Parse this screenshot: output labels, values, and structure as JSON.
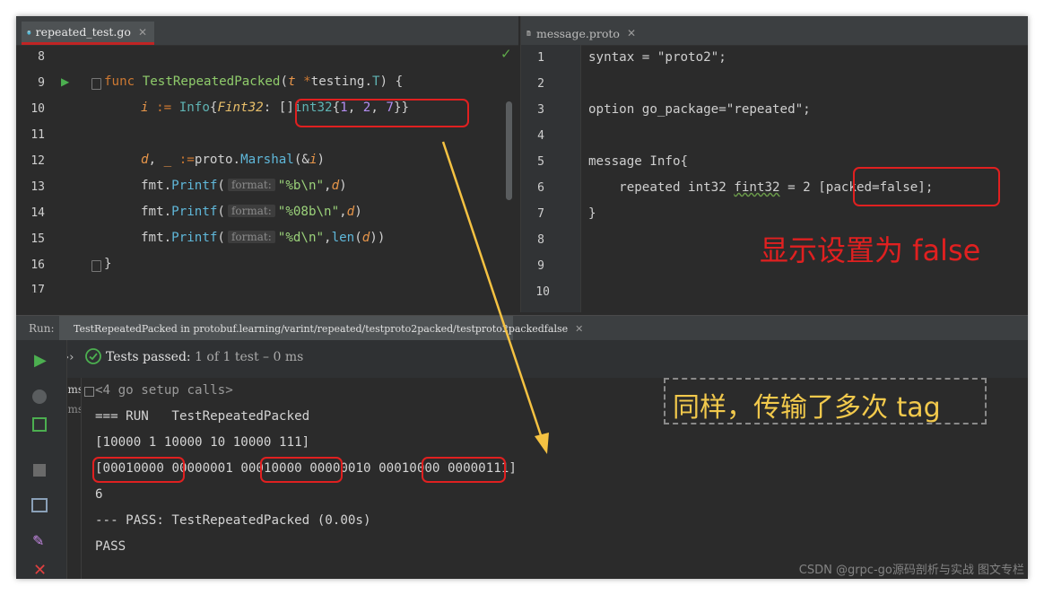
{
  "left_editor": {
    "tab_label": "repeated_test.go",
    "lines": [
      {
        "num": "8"
      },
      {
        "num": "9",
        "func_kw": "func",
        "func_name": "TestRepeatedPacked",
        "param": "t",
        "star": "*",
        "pkg": "testing.",
        "type": "T",
        "tail": ") {"
      },
      {
        "num": "10",
        "var": "i",
        "op": " := ",
        "type": "Info",
        "brace": "{",
        "field": "Fint32",
        "colon": ": ",
        "slice": "[]",
        "elem": "int32",
        "open": "{",
        "n1": "1",
        "c1": ", ",
        "n2": "2",
        "c2": ", ",
        "n3": "7",
        "close": "}}"
      },
      {
        "num": "11"
      },
      {
        "num": "12",
        "var1": "d",
        "sep": ", ",
        "var2": "_",
        "op": " :=",
        "pkg": "proto.",
        "method": "Marshal",
        "amp": "(&",
        "arg": "i",
        "close": ")"
      },
      {
        "num": "13",
        "pkg": "fmt.",
        "method": "Printf",
        "open": "(",
        "hint": "format:",
        "str": "\"%b\\n\"",
        "comma": ",",
        "arg": "d",
        "close": ")"
      },
      {
        "num": "14",
        "pkg": "fmt.",
        "method": "Printf",
        "open": "(",
        "hint": "format:",
        "str": "\"%08b\\n\"",
        "comma": ",",
        "arg": "d",
        "close": ")"
      },
      {
        "num": "15",
        "pkg": "fmt.",
        "method": "Printf",
        "open": "(",
        "hint": "format:",
        "str": "\"%d\\n\"",
        "comma": ",",
        "fn": "len",
        "open2": "(",
        "arg": "d",
        "close": "))"
      },
      {
        "num": "16",
        "text": "}"
      },
      {
        "num": "17"
      }
    ]
  },
  "right_editor": {
    "tab_label": "message.proto",
    "lines": [
      {
        "num": "1",
        "text": "syntax = \"proto2\";"
      },
      {
        "num": "2",
        "text": ""
      },
      {
        "num": "3",
        "text": "option go_package=\"repeated\";"
      },
      {
        "num": "4",
        "text": ""
      },
      {
        "num": "5",
        "text": "message Info{"
      },
      {
        "num": "6",
        "pre": "    repeated int32 ",
        "field": "fint32",
        "mid": " = 2 ",
        "opt": "[packed=false];"
      },
      {
        "num": "7",
        "text": "}"
      },
      {
        "num": "8",
        "text": ""
      },
      {
        "num": "9",
        "text": ""
      },
      {
        "num": "10",
        "text": ""
      }
    ]
  },
  "annotations": {
    "packed_note": "显示设置为 false",
    "tag_note": "同样，传输了多次 tag",
    "colors": {
      "red": "#e02020",
      "yellow": "#f2c94c",
      "arrow": "#f5c242"
    }
  },
  "run_panel": {
    "run_label": "Run:",
    "config_name": "TestRepeatedPacked in protobuf.learning/varint/repeated/testproto2packed/testproto2packedfalse",
    "tests_passed_label": "Tests passed:",
    "tests_passed_detail": "1 of 1 test – 0 ms",
    "time_1": "0 ms",
    "time_2": "0 ms",
    "console": {
      "setup": "<4 go setup calls>",
      "run_line": "=== RUN   TestRepeatedPacked",
      "decimal_line": "[10000 1 10000 10 10000 111]",
      "bin_bytes": [
        "00010000",
        "00000001",
        "00010000",
        "00000010",
        "00010000",
        "00000111"
      ],
      "len_line": "6",
      "pass_line": "--- PASS: TestRepeatedPacked (0.00s)",
      "pass": "PASS"
    }
  },
  "watermark": "CSDN @grpc-go源码剖析与实战 图文专栏"
}
